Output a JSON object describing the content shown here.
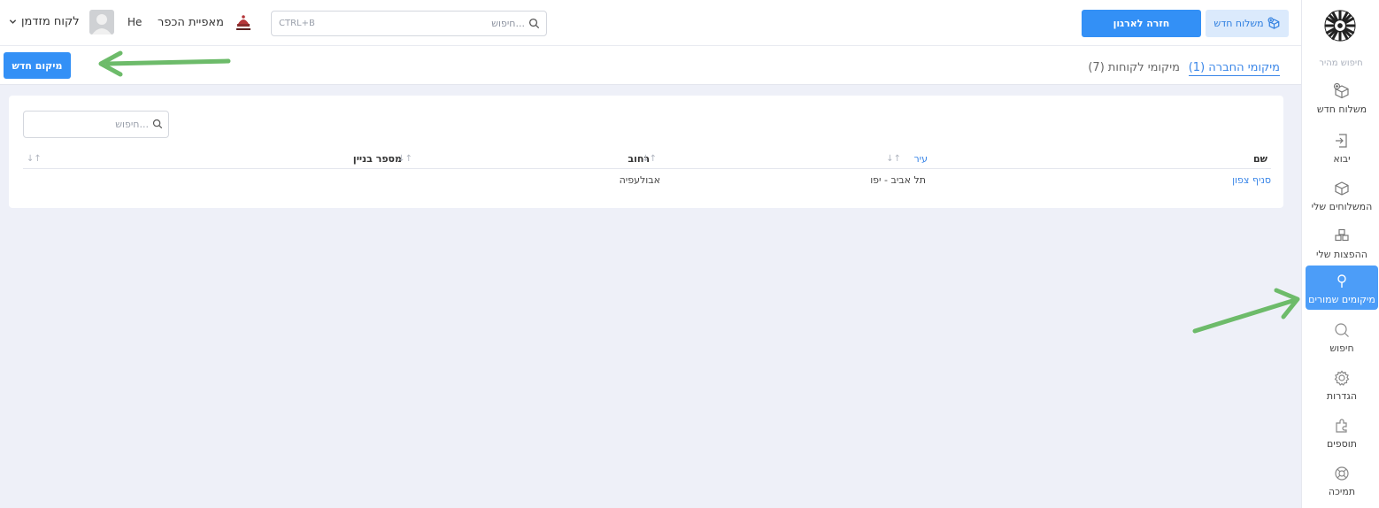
{
  "sidebar": {
    "quick_search": "חיפוש מהיר",
    "items": [
      {
        "label": "משלוח חדש",
        "icon": "box-add-icon"
      },
      {
        "label": "יבוא",
        "icon": "import-icon"
      },
      {
        "label": "המשלוחים שלי",
        "icon": "box-icon"
      },
      {
        "label": "ההפצות שלי",
        "icon": "boxes-icon"
      },
      {
        "label": "מיקומים שמורים",
        "icon": "pin-icon",
        "active": true
      },
      {
        "label": "חיפוש",
        "icon": "search-icon"
      },
      {
        "label": "הגדרות",
        "icon": "gear-icon"
      },
      {
        "label": "תוספים",
        "icon": "puzzle-icon"
      },
      {
        "label": "תמיכה",
        "icon": "lifebuoy-icon"
      }
    ]
  },
  "topbar": {
    "new_shipment_label": "משלוח חדש",
    "back_to_org_label": "חזרה לארגון",
    "search": {
      "placeholder": "חיפוש...",
      "shortcut": "CTRL+B"
    },
    "bakery_name": "מאפיית הכפר",
    "language": "He",
    "user_menu_label": "לקוח מזדמן"
  },
  "tabs": [
    {
      "label": "מיקומי החברה (1)",
      "active": true
    },
    {
      "label": "מיקומי לקוחות (7)",
      "active": false
    }
  ],
  "new_location_label": "מיקום חדש",
  "table": {
    "search_placeholder": "חיפוש...",
    "columns": [
      "שם",
      "עיר",
      "רחוב",
      "מספר בניין"
    ],
    "rows": [
      {
        "name": "סניף צפון",
        "city": "תל אביב - יפו",
        "street": "אבולעפיה",
        "building": ""
      }
    ]
  },
  "colors": {
    "primary": "#3390f6",
    "active_sidebar": "#4c9df8",
    "arrow": "#6dbb6a",
    "background": "#eef0f8"
  }
}
